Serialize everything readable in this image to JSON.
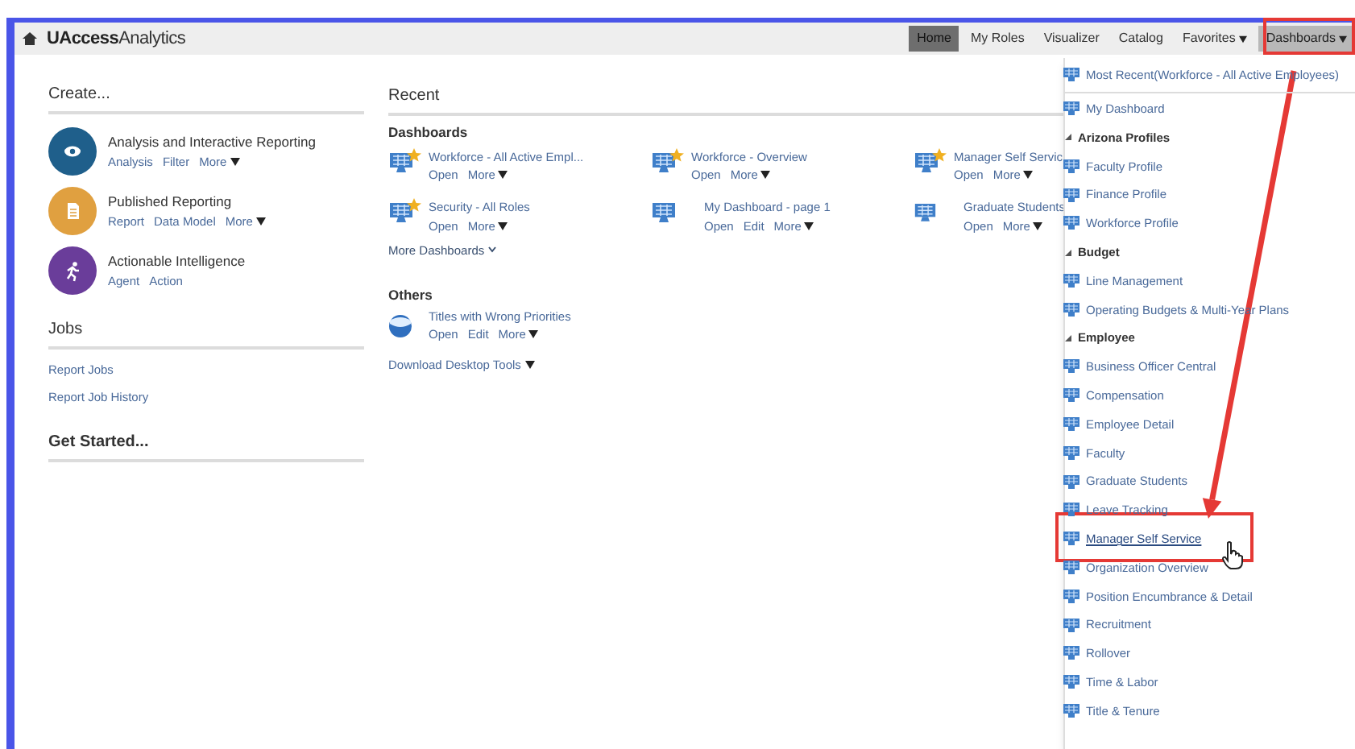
{
  "app": {
    "title_part_1": "UAccess",
    "title_part_2": "Analytics"
  },
  "nav": [
    {
      "label": "Home",
      "selected": true,
      "open": false,
      "menu": false
    },
    {
      "label": "My Roles",
      "selected": false,
      "open": false,
      "menu": false
    },
    {
      "label": "Visualizer",
      "selected": false,
      "open": false,
      "menu": false
    },
    {
      "label": "Catalog",
      "selected": false,
      "open": false,
      "menu": false
    },
    {
      "label": "Favorites",
      "selected": false,
      "open": false,
      "menu": true
    },
    {
      "label": "Dashboards",
      "selected": false,
      "open": true,
      "menu": true
    }
  ],
  "create": {
    "title": "Create...",
    "items": [
      {
        "title": "Analysis and Interactive Reporting",
        "kind": "analysis",
        "color": "#1f5f8b",
        "actions": [
          {
            "label": "Analysis",
            "menu": false
          },
          {
            "label": "Filter",
            "menu": false
          },
          {
            "label": "More",
            "menu": true
          }
        ]
      },
      {
        "title": "Published Reporting",
        "kind": "report",
        "color": "#e0a040",
        "actions": [
          {
            "label": "Report",
            "menu": false
          },
          {
            "label": "Data Model",
            "menu": false
          },
          {
            "label": "More",
            "menu": true
          }
        ]
      },
      {
        "title": "Actionable Intelligence",
        "kind": "agent",
        "color": "#6a3d9a",
        "actions": [
          {
            "label": "Agent",
            "menu": false
          },
          {
            "label": "Action",
            "menu": false
          }
        ]
      }
    ]
  },
  "jobs": {
    "title": "Jobs",
    "links": [
      "Report Jobs",
      "Report Job History"
    ]
  },
  "get_started": {
    "title": "Get Started..."
  },
  "recent": {
    "title": "Recent",
    "dashboards": {
      "title": "Dashboards",
      "items": [
        {
          "title": "Workforce - All Active Empl...",
          "favorite": true,
          "actions": [
            {
              "label": "Open",
              "menu": false
            },
            {
              "label": "More",
              "menu": true
            }
          ]
        },
        {
          "title": "Workforce - Overview",
          "favorite": true,
          "actions": [
            {
              "label": "Open",
              "menu": false
            },
            {
              "label": "More",
              "menu": true
            }
          ]
        },
        {
          "title": "Manager Self Servic",
          "favorite": true,
          "actions": [
            {
              "label": "Open",
              "menu": false
            },
            {
              "label": "More",
              "menu": true
            }
          ]
        },
        {
          "title": "Security - All Roles",
          "favorite": true,
          "actions": [
            {
              "label": "Open",
              "menu": false
            },
            {
              "label": "More",
              "menu": true
            }
          ]
        },
        {
          "title": "My Dashboard - page 1",
          "favorite": false,
          "actions": [
            {
              "label": "Open",
              "menu": false
            },
            {
              "label": "Edit",
              "menu": false
            },
            {
              "label": "More",
              "menu": true
            }
          ]
        },
        {
          "title": "Graduate Students",
          "favorite": false,
          "actions": [
            {
              "label": "Open",
              "menu": false
            },
            {
              "label": "More",
              "menu": true
            }
          ]
        }
      ]
    },
    "more_link": "More Dashboards",
    "others": {
      "title": "Others",
      "items": [
        {
          "title": "Titles with Wrong Priorities",
          "actions": [
            {
              "label": "Open",
              "menu": false
            },
            {
              "label": "Edit",
              "menu": false
            },
            {
              "label": "More",
              "menu": true
            }
          ]
        }
      ]
    },
    "download": "Download Desktop Tools"
  },
  "dashboards_menu": [
    {
      "kind": "item",
      "label": "Most Recent(Workforce - All Active Employees)",
      "hovered": false
    },
    {
      "kind": "separator"
    },
    {
      "kind": "item",
      "label": "My Dashboard",
      "hovered": false
    },
    {
      "kind": "group",
      "label": "Arizona Profiles",
      "children": [
        {
          "kind": "item",
          "label": "Faculty Profile",
          "hovered": false
        },
        {
          "kind": "item",
          "label": "Finance Profile",
          "hovered": false
        },
        {
          "kind": "item",
          "label": "Workforce Profile",
          "hovered": false
        }
      ]
    },
    {
      "kind": "group",
      "label": "Budget",
      "children": [
        {
          "kind": "item",
          "label": "Line Management",
          "hovered": false
        },
        {
          "kind": "item",
          "label": "Operating Budgets & Multi-Year Plans",
          "hovered": false
        }
      ]
    },
    {
      "kind": "group",
      "label": "Employee",
      "children": [
        {
          "kind": "item",
          "label": "Business Officer Central",
          "hovered": false
        },
        {
          "kind": "item",
          "label": "Compensation",
          "hovered": false
        },
        {
          "kind": "item",
          "label": "Employee Detail",
          "hovered": false
        },
        {
          "kind": "item",
          "label": "Faculty",
          "hovered": false
        },
        {
          "kind": "item",
          "label": "Graduate Students",
          "hovered": false
        },
        {
          "kind": "item",
          "label": "Leave Tracking",
          "hovered": false
        },
        {
          "kind": "item",
          "label": "Manager Self Service",
          "hovered": true
        },
        {
          "kind": "item",
          "label": "Organization Overview",
          "hovered": false
        },
        {
          "kind": "item",
          "label": "Position Encumbrance & Detail",
          "hovered": false
        },
        {
          "kind": "item",
          "label": "Recruitment",
          "hovered": false
        },
        {
          "kind": "item",
          "label": "Rollover",
          "hovered": false
        },
        {
          "kind": "item",
          "label": "Time & Labor",
          "hovered": false
        },
        {
          "kind": "item",
          "label": "Title & Tenure",
          "hovered": false
        }
      ]
    }
  ]
}
